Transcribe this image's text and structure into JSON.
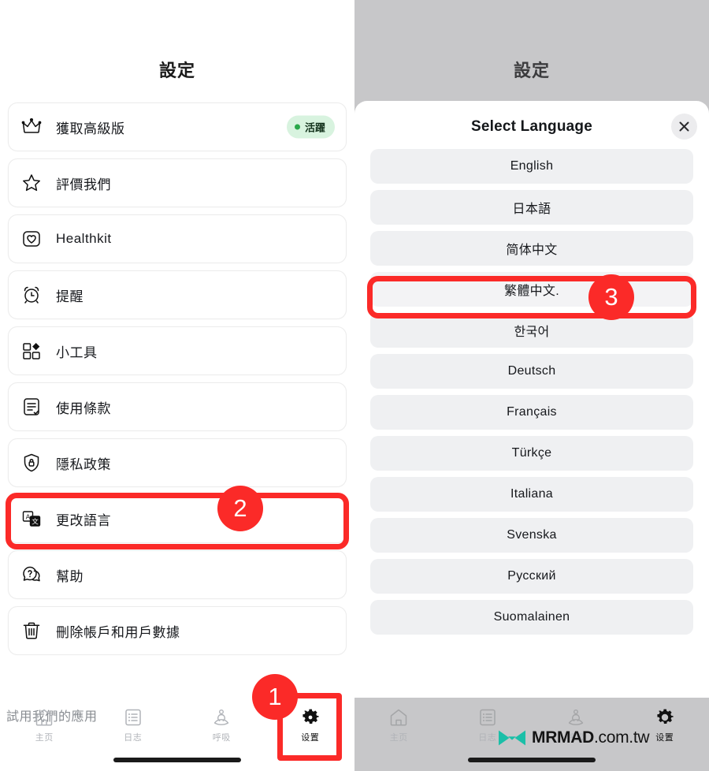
{
  "left": {
    "nav_title": "設定",
    "settings_items": [
      {
        "icon": "crown-icon",
        "label": "獲取高級版",
        "badge": "活躍"
      },
      {
        "icon": "star-icon",
        "label": "評價我們",
        "badge": null
      },
      {
        "icon": "healthkit-heart-icon",
        "label": "Healthkit",
        "badge": null
      },
      {
        "icon": "alarm-clock-icon",
        "label": "提醒",
        "badge": null
      },
      {
        "icon": "widgets-icon",
        "label": "小工具",
        "badge": null
      },
      {
        "icon": "terms-document-icon",
        "label": "使用條款",
        "badge": null
      },
      {
        "icon": "shield-lock-icon",
        "label": "隱私政策",
        "badge": null
      },
      {
        "icon": "translate-icon",
        "label": "更改語言",
        "badge": null
      },
      {
        "icon": "help-question-icon",
        "label": "幫助",
        "badge": null
      },
      {
        "icon": "trash-icon",
        "label": "刪除帳戶和用戶數據",
        "badge": null
      }
    ],
    "try_apps_label": "試用我們的應用",
    "tabs": [
      {
        "icon": "home-icon",
        "label": "主页",
        "active": false
      },
      {
        "icon": "journal-icon",
        "label": "日志",
        "active": false
      },
      {
        "icon": "breathe-icon",
        "label": "呼吸",
        "active": false
      },
      {
        "icon": "gear-icon",
        "label": "设置",
        "active": true
      }
    ]
  },
  "right": {
    "nav_title": "設定",
    "sheet_title": "Select Language",
    "close_icon": "close-icon",
    "languages": [
      "English",
      "日本語",
      "简体中文",
      "繁體中文.",
      "한국어",
      "Deutsch",
      "Français",
      "Türkçe",
      "Italiana",
      "Svenska",
      "Русский",
      "Suomalainen"
    ],
    "selected_language": "繁體中文.",
    "tabs": [
      {
        "icon": "home-icon",
        "label": "主页",
        "active": false
      },
      {
        "icon": "journal-icon",
        "label": "日志",
        "active": false
      },
      {
        "icon": "breathe-icon",
        "label": "呼吸",
        "active": false
      },
      {
        "icon": "gear-icon",
        "label": "设置",
        "active": true
      }
    ]
  },
  "annotations": {
    "steps": [
      {
        "number": "1",
        "target": "settings-tab"
      },
      {
        "number": "2",
        "target": "change-language-row"
      },
      {
        "number": "3",
        "target": "traditional-chinese-option"
      }
    ],
    "highlight_color": "#fb2a28"
  },
  "watermark": {
    "brand": "MRMAD",
    "suffix": ".com.tw",
    "logo": "mrmad-logo-icon",
    "color": "#1bbfa8"
  }
}
